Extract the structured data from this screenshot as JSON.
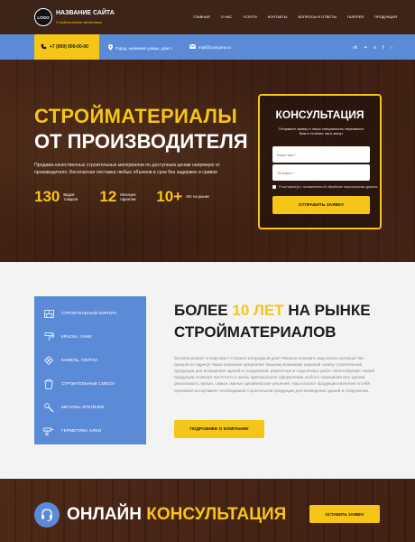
{
  "header": {
    "logo_text": "LOGO",
    "site_title": "НАЗВАНИЕ САЙТА",
    "site_subtitle": "Стройительные материалы",
    "nav": [
      "ГЛАВНАЯ",
      "О НАС",
      "УСЛУГИ",
      "КОНТАКТЫ",
      "ВОПРОСЫ И ОТВЕТЫ",
      "ГАЛЕРЕЯ",
      "ПРОДУКЦИЯ"
    ]
  },
  "infobar": {
    "phone": "+7 (000) 000-00-00",
    "address": "Город, название улицы, дом 1",
    "email": "mail@company.ru",
    "socials": [
      "vk-icon",
      "twitter-icon",
      "skype-icon",
      "facebook-icon",
      "odnoklassniki-icon"
    ]
  },
  "hero": {
    "title_line1": "СТРОЙМАТЕРИАЛЫ",
    "title_line2": "ОТ ПРОИЗВОДИТЕЛЯ",
    "description": "Продажа качественных строительных материалов по доступным ценам напрямую от производителя. Бесплатная поставка любых объемов в срок без задержек и сривов",
    "stats": [
      {
        "number": "130",
        "label": "Видов товаров"
      },
      {
        "number": "12",
        "label": "Месяцев гарантии"
      },
      {
        "number": "10+",
        "label": "Лет на рынке"
      }
    ]
  },
  "form": {
    "title": "КОНСУЛЬТАЦИЯ",
    "subtitle": "Отправьте заявку и наши специалисты перезвонят Вам в течение пяти минут",
    "name_placeholder": "Ваше имя *",
    "phone_placeholder": "Телефон *",
    "consent": "Я согласен(а) с положением об обработке персональных данных",
    "submit": "ОТПРАВИТЬ ЗАЯВКУ"
  },
  "about": {
    "categories": [
      {
        "label": "СТРОИТЕЛЬНЫЙ КИРПИЧ",
        "icon": "brick-icon"
      },
      {
        "label": "КРАСКА, ЛАКИ",
        "icon": "paint-roller-icon"
      },
      {
        "label": "КАФЕЛЬ, ПЛИТКА",
        "icon": "tile-icon"
      },
      {
        "label": "СТРОИТЕЛЬНЫЕ СМЕСИ",
        "icon": "cement-bag-icon"
      },
      {
        "label": "МЕТИЗЫ, КРЕПЕЖИ",
        "icon": "screw-icon"
      },
      {
        "label": "ГЕРМЕТИКИ, КЛЕИ",
        "icon": "sealant-gun-icon"
      }
    ],
    "title_prefix": "БОЛЕЕ ",
    "title_accent": "10 ЛЕТ",
    "title_suffix": " НА РЫНКЕ",
    "title_line2": "СТРОЙМАТЕРИАЛОВ",
    "text": "Затеяли ремонт в квартире? Строите загородный дом? Решили освежить вид своего жилища? Вы пришли по адресу! Наша компания предлагает Вашему вниманию широкий спектр строительной продукции для возведения зданий и сооружений, ремонтных и отделочных работ. Многообразие нашей продукции позволит воплотить в жизнь оригинальное оформление любого помещения или здания, реализовать любые, самые смелые дизайнерские решения. Наш каталог продукции включает в себя огромный ассортимент необходимой строительной продукции для возведения зданий и сооружения.",
    "button": "ПОДРОБНЕЕ О КОМПАНИИ"
  },
  "online": {
    "title_prefix": "ОНЛАЙН ",
    "title_accent": "КОНСУЛЬТАЦИЯ",
    "button": "ОСТАВИТЬ ЗАЯВКУ"
  },
  "colors": {
    "accent_yellow": "#f5c518",
    "accent_blue": "#5b8bd6",
    "header_bg": "#3d2418"
  }
}
